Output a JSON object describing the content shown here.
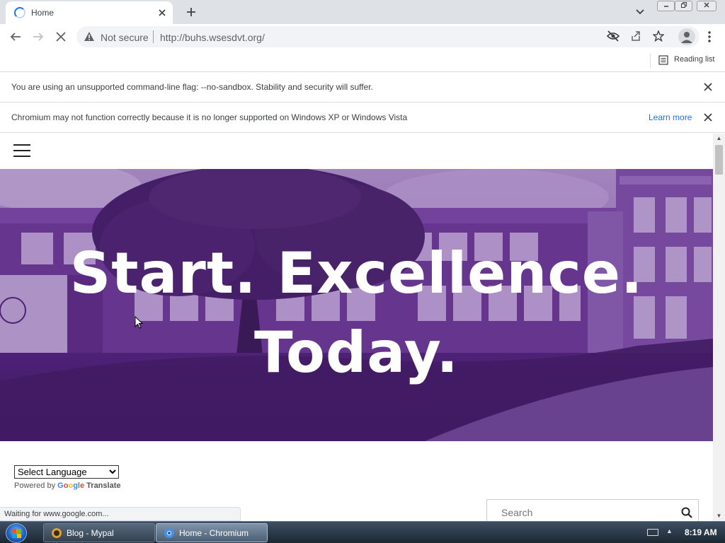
{
  "browser": {
    "tab": {
      "title": "Home"
    },
    "toolbar": {
      "security_label": "Not secure",
      "url": "http://buhs.wsesdvt.org/"
    },
    "reading_list_label": "Reading list",
    "infobars": [
      {
        "text": "You are using an unsupported command-line flag: --no-sandbox. Stability and security will suffer."
      },
      {
        "text": "Chromium may not function correctly because it is no longer supported on Windows XP or Windows Vista",
        "link": "Learn more"
      }
    ],
    "status_text": "Waiting for www.google.com..."
  },
  "page": {
    "hero": {
      "line1": "Start. Excellence.",
      "line2": "Today."
    },
    "translate": {
      "select_label": "Select Language",
      "powered_by": "Powered by",
      "google_logo": "Google",
      "translate_label": "Translate"
    },
    "search": {
      "placeholder": "Search"
    }
  },
  "taskbar": {
    "items": [
      {
        "label": "Blog - Mypal",
        "active": false
      },
      {
        "label": "Home - Chromium",
        "active": true
      }
    ],
    "clock": "8:19 AM"
  },
  "colors": {
    "hero_tint": "#5a2a86",
    "link_blue": "#1a73e8",
    "loading_blue": "#1a73e8"
  },
  "icons": [
    "loading-spinner-icon",
    "close-icon",
    "plus-icon",
    "chevron-down-icon",
    "back-arrow-icon",
    "forward-arrow-icon",
    "stop-icon",
    "warning-icon",
    "eye-off-icon",
    "share-icon",
    "star-icon",
    "profile-icon",
    "more-vert-icon",
    "reading-list-icon",
    "hamburger-icon",
    "search-icon",
    "windows-orb-icon",
    "keyboard-icon",
    "clock"
  ]
}
